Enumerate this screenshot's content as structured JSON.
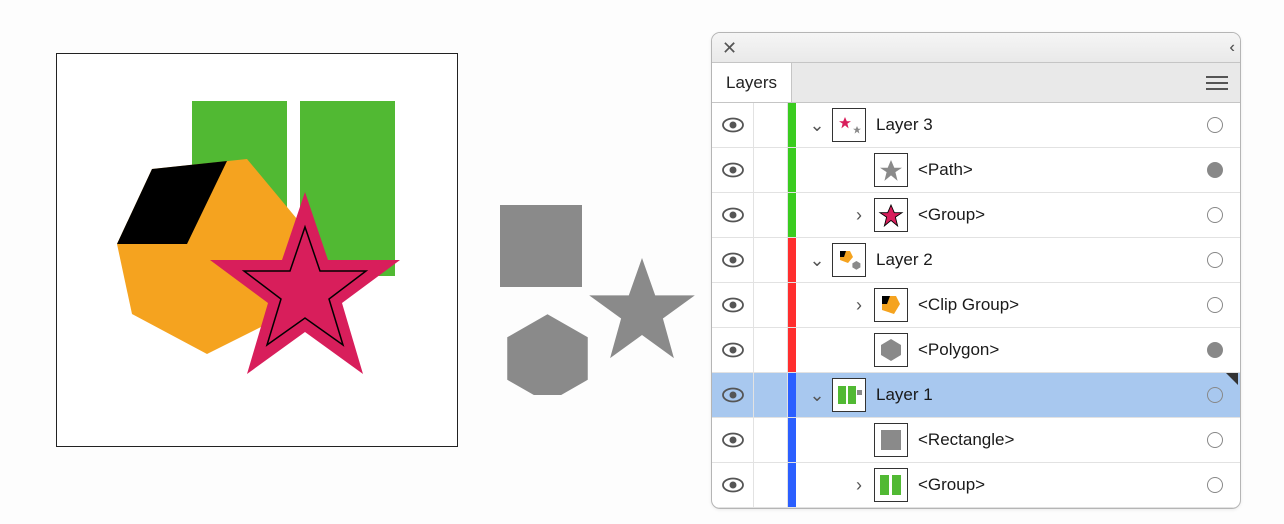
{
  "panel": {
    "title": "Layers",
    "close_glyph": "✕",
    "collapse_glyph": "‹‹"
  },
  "colors": {
    "green_strip": "#3acc1f",
    "red_strip": "#ff2e2e",
    "blue_strip": "#2b5fff",
    "green_shape": "#51b933",
    "orange_shape": "#f5a31f",
    "black_shape": "#000000",
    "crimson_shape": "#d81e5b",
    "grey_shape": "#8a8a8a"
  },
  "rows": [
    {
      "id": "layer3",
      "label": "Layer 3",
      "color_key": "green_strip",
      "indent": 0,
      "arrow": "down",
      "thumb": "layer3",
      "target": "empty",
      "selected": false
    },
    {
      "id": "path",
      "label": "<Path>",
      "color_key": "green_strip",
      "indent": 1,
      "arrow": "none",
      "thumb": "greystar",
      "target": "filled",
      "selected": false
    },
    {
      "id": "group3",
      "label": "<Group>",
      "color_key": "green_strip",
      "indent": 1,
      "arrow": "right",
      "thumb": "redstar",
      "target": "empty",
      "selected": false
    },
    {
      "id": "layer2",
      "label": "Layer 2",
      "color_key": "red_strip",
      "indent": 0,
      "arrow": "down",
      "thumb": "layer2",
      "target": "empty",
      "selected": false
    },
    {
      "id": "clipgroup",
      "label": "<Clip Group>",
      "color_key": "red_strip",
      "indent": 1,
      "arrow": "right",
      "thumb": "clipgroup",
      "target": "empty",
      "selected": false
    },
    {
      "id": "polygon",
      "label": "<Polygon>",
      "color_key": "red_strip",
      "indent": 1,
      "arrow": "none",
      "thumb": "greyhex",
      "target": "filled",
      "selected": false
    },
    {
      "id": "layer1",
      "label": "Layer 1",
      "color_key": "blue_strip",
      "indent": 0,
      "arrow": "down",
      "thumb": "layer1",
      "target": "empty",
      "selected": true
    },
    {
      "id": "rect",
      "label": "<Rectangle>",
      "color_key": "blue_strip",
      "indent": 1,
      "arrow": "none",
      "thumb": "greyrect",
      "target": "empty",
      "selected": false
    },
    {
      "id": "group1",
      "label": "<Group>",
      "color_key": "blue_strip",
      "indent": 1,
      "arrow": "right",
      "thumb": "tworects",
      "target": "empty",
      "selected": false
    }
  ]
}
